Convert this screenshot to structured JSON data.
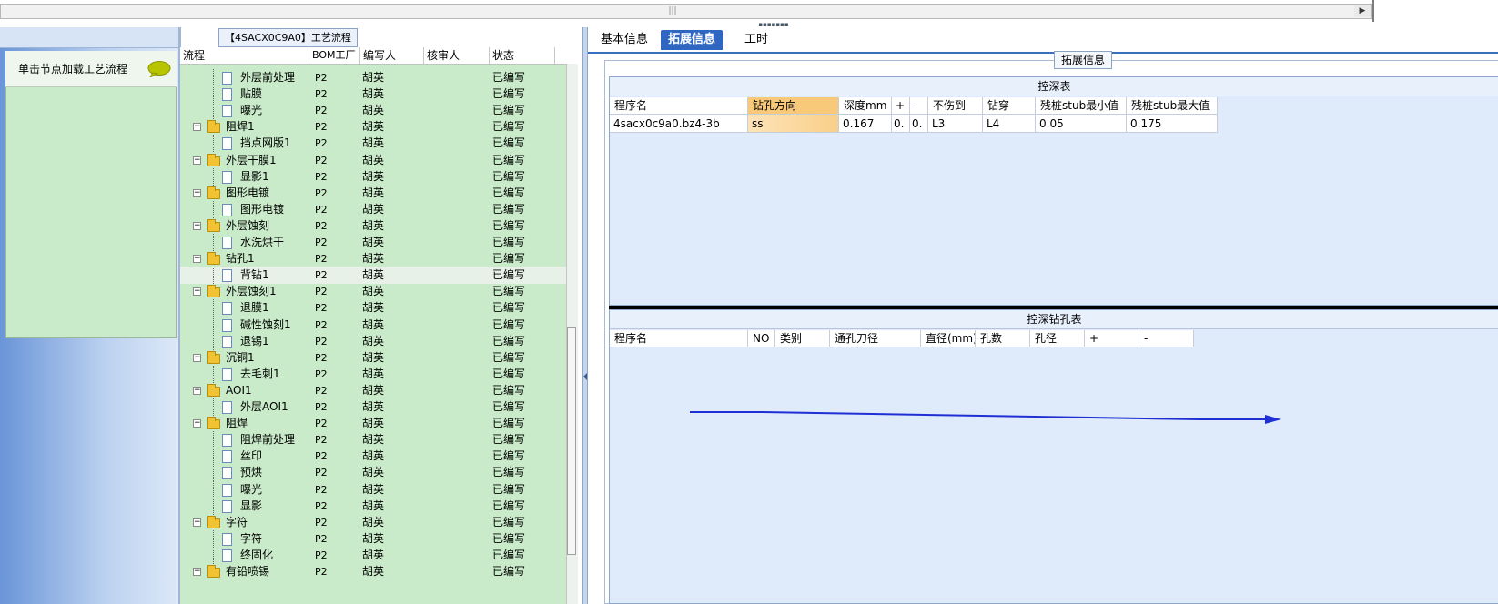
{
  "topbar": {
    "scroll_grip": "|||",
    "scroll_right": "▶"
  },
  "left": {
    "hint": "单击节点加载工艺流程"
  },
  "tree": {
    "title": "【4SACX0C9A0】工艺流程",
    "columns": [
      "流程",
      "BOM工厂",
      "编写人",
      "核审人",
      "状态"
    ],
    "rows": [
      {
        "level": 2,
        "name": "外层前处理",
        "bom": "P2",
        "author": "胡英",
        "reviewer": "",
        "status": "已编写"
      },
      {
        "level": 2,
        "name": "贴膜",
        "bom": "P2",
        "author": "胡英",
        "reviewer": "",
        "status": "已编写"
      },
      {
        "level": 2,
        "name": "曝光",
        "bom": "P2",
        "author": "胡英",
        "reviewer": "",
        "status": "已编写"
      },
      {
        "level": 1,
        "name": "阻焊1",
        "bom": "P2",
        "author": "胡英",
        "reviewer": "",
        "status": "已编写"
      },
      {
        "level": 2,
        "name": "挡点网版1",
        "bom": "P2",
        "author": "胡英",
        "reviewer": "",
        "status": "已编写"
      },
      {
        "level": 1,
        "name": "外层干膜1",
        "bom": "P2",
        "author": "胡英",
        "reviewer": "",
        "status": "已编写"
      },
      {
        "level": 2,
        "name": "显影1",
        "bom": "P2",
        "author": "胡英",
        "reviewer": "",
        "status": "已编写"
      },
      {
        "level": 1,
        "name": "图形电镀",
        "bom": "P2",
        "author": "胡英",
        "reviewer": "",
        "status": "已编写"
      },
      {
        "level": 2,
        "name": "图形电镀",
        "bom": "P2",
        "author": "胡英",
        "reviewer": "",
        "status": "已编写"
      },
      {
        "level": 1,
        "name": "外层蚀刻",
        "bom": "P2",
        "author": "胡英",
        "reviewer": "",
        "status": "已编写"
      },
      {
        "level": 2,
        "name": "水洗烘干",
        "bom": "P2",
        "author": "胡英",
        "reviewer": "",
        "status": "已编写"
      },
      {
        "level": 1,
        "name": "钻孔1",
        "bom": "P2",
        "author": "胡英",
        "reviewer": "",
        "status": "已编写"
      },
      {
        "level": 2,
        "name": "背钻1",
        "bom": "P2",
        "author": "胡英",
        "reviewer": "",
        "status": "已编写",
        "selected": true
      },
      {
        "level": 1,
        "name": "外层蚀刻1",
        "bom": "P2",
        "author": "胡英",
        "reviewer": "",
        "status": "已编写"
      },
      {
        "level": 2,
        "name": "退膜1",
        "bom": "P2",
        "author": "胡英",
        "reviewer": "",
        "status": "已编写"
      },
      {
        "level": 2,
        "name": "碱性蚀刻1",
        "bom": "P2",
        "author": "胡英",
        "reviewer": "",
        "status": "已编写"
      },
      {
        "level": 2,
        "name": "退锡1",
        "bom": "P2",
        "author": "胡英",
        "reviewer": "",
        "status": "已编写"
      },
      {
        "level": 1,
        "name": "沉铜1",
        "bom": "P2",
        "author": "胡英",
        "reviewer": "",
        "status": "已编写"
      },
      {
        "level": 2,
        "name": "去毛刺1",
        "bom": "P2",
        "author": "胡英",
        "reviewer": "",
        "status": "已编写"
      },
      {
        "level": 1,
        "name": "AOI1",
        "bom": "P2",
        "author": "胡英",
        "reviewer": "",
        "status": "已编写"
      },
      {
        "level": 2,
        "name": "外层AOI1",
        "bom": "P2",
        "author": "胡英",
        "reviewer": "",
        "status": "已编写"
      },
      {
        "level": 1,
        "name": "阻焊",
        "bom": "P2",
        "author": "胡英",
        "reviewer": "",
        "status": "已编写"
      },
      {
        "level": 2,
        "name": "阻焊前处理",
        "bom": "P2",
        "author": "胡英",
        "reviewer": "",
        "status": "已编写"
      },
      {
        "level": 2,
        "name": "丝印",
        "bom": "P2",
        "author": "胡英",
        "reviewer": "",
        "status": "已编写"
      },
      {
        "level": 2,
        "name": "预烘",
        "bom": "P2",
        "author": "胡英",
        "reviewer": "",
        "status": "已编写"
      },
      {
        "level": 2,
        "name": "曝光",
        "bom": "P2",
        "author": "胡英",
        "reviewer": "",
        "status": "已编写"
      },
      {
        "level": 2,
        "name": "显影",
        "bom": "P2",
        "author": "胡英",
        "reviewer": "",
        "status": "已编写"
      },
      {
        "level": 1,
        "name": "字符",
        "bom": "P2",
        "author": "胡英",
        "reviewer": "",
        "status": "已编写"
      },
      {
        "level": 2,
        "name": "字符",
        "bom": "P2",
        "author": "胡英",
        "reviewer": "",
        "status": "已编写"
      },
      {
        "level": 2,
        "name": "终固化",
        "bom": "P2",
        "author": "胡英",
        "reviewer": "",
        "status": "已编写"
      },
      {
        "level": 1,
        "name": "有铅喷锡",
        "bom": "P2",
        "author": "胡英",
        "reviewer": "",
        "status": "已编写"
      }
    ]
  },
  "right": {
    "tabs": [
      "基本信息",
      "拓展信息",
      "工时"
    ],
    "active_tab": 1,
    "ext_label": "拓展信息",
    "depth_table": {
      "title": "控深表",
      "columns": [
        "程序名",
        "钻孔方向",
        "深度mm",
        "+",
        "-",
        "不伤到",
        "钻穿",
        "残桩stub最小值",
        "残桩stub最大值"
      ],
      "row": [
        "4sacx0c9a0.bz4-3b",
        "ss",
        "0.167",
        "0.",
        "0.",
        "L3",
        "L4",
        "0.05",
        "0.175"
      ]
    },
    "hole_table": {
      "title": "控深钻孔表",
      "columns": [
        "程序名",
        "NO",
        "类别",
        "通孔刀径",
        "直径(mm)",
        "孔数",
        "孔径",
        "+",
        "-"
      ]
    },
    "arrow_color": "#1f2fd6"
  }
}
